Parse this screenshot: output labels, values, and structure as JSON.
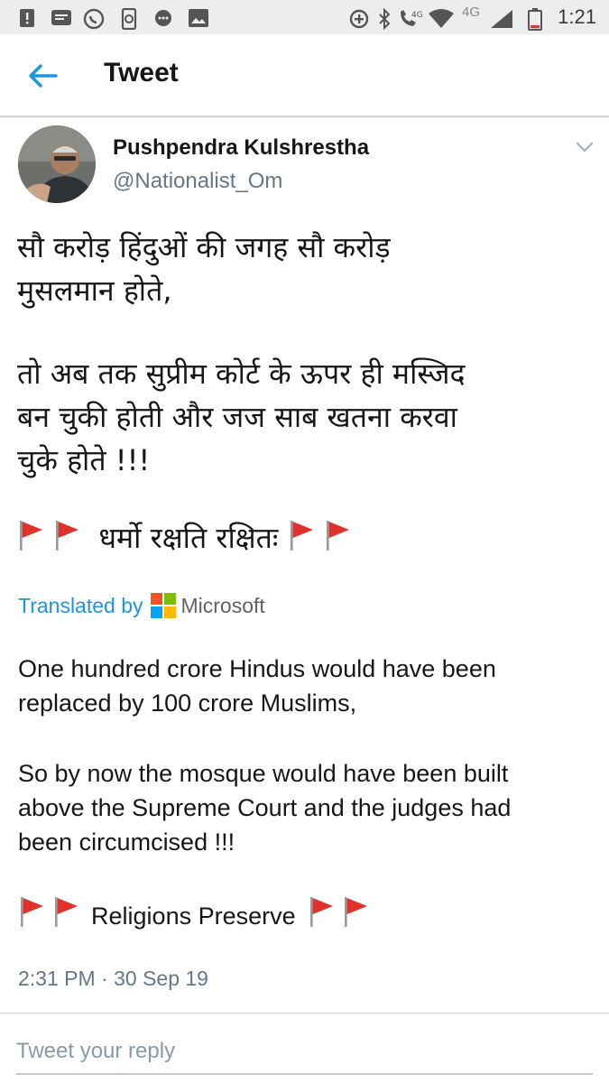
{
  "status_bar": {
    "time": "1:21",
    "network_label": "4G",
    "network_label_2": "4G",
    "icons": [
      "alert-icon",
      "message-icon",
      "whatsapp-icon",
      "phone-sync-icon",
      "chat-icon",
      "image-icon",
      "data-saver-icon",
      "bluetooth-icon",
      "volte-call-icon",
      "wifi-icon",
      "signal-icon",
      "battery-icon"
    ]
  },
  "app_bar": {
    "title": "Tweet",
    "back_icon": "arrow-left-icon"
  },
  "tweet": {
    "author_name": "Pushpendra Kulshrestha",
    "author_handle": "@Nationalist_Om",
    "hindi_lines": [
      "सौ करोड़ हिंदुओं की जगह सौ करोड़",
      "मुसलमान होते,",
      "तो अब तक सुप्रीम कोर्ट के ऊपर ही मस्जिद",
      "बन चुकी होती और जज साब खतना करवा",
      "चुके होते !!!"
    ],
    "hindi_motto": "धर्मो रक्षति रक्षितः",
    "translated_by": "Translated by",
    "translator": "Microsoft",
    "english_lines": [
      "One hundred crore Hindus would have been",
      "replaced by 100 crore Muslims,",
      "So by now the mosque would have been built",
      "above the Supreme Court and the judges had",
      "been circumcised !!!"
    ],
    "english_motto": "Religions Preserve",
    "timestamp": "2:31 PM · 30 Sep 19"
  },
  "reply": {
    "placeholder": "Tweet your reply"
  },
  "colors": {
    "accent": "#1b95e0",
    "text": "#14171a",
    "secondary": "#657786",
    "flag_red": "#e0322b"
  }
}
